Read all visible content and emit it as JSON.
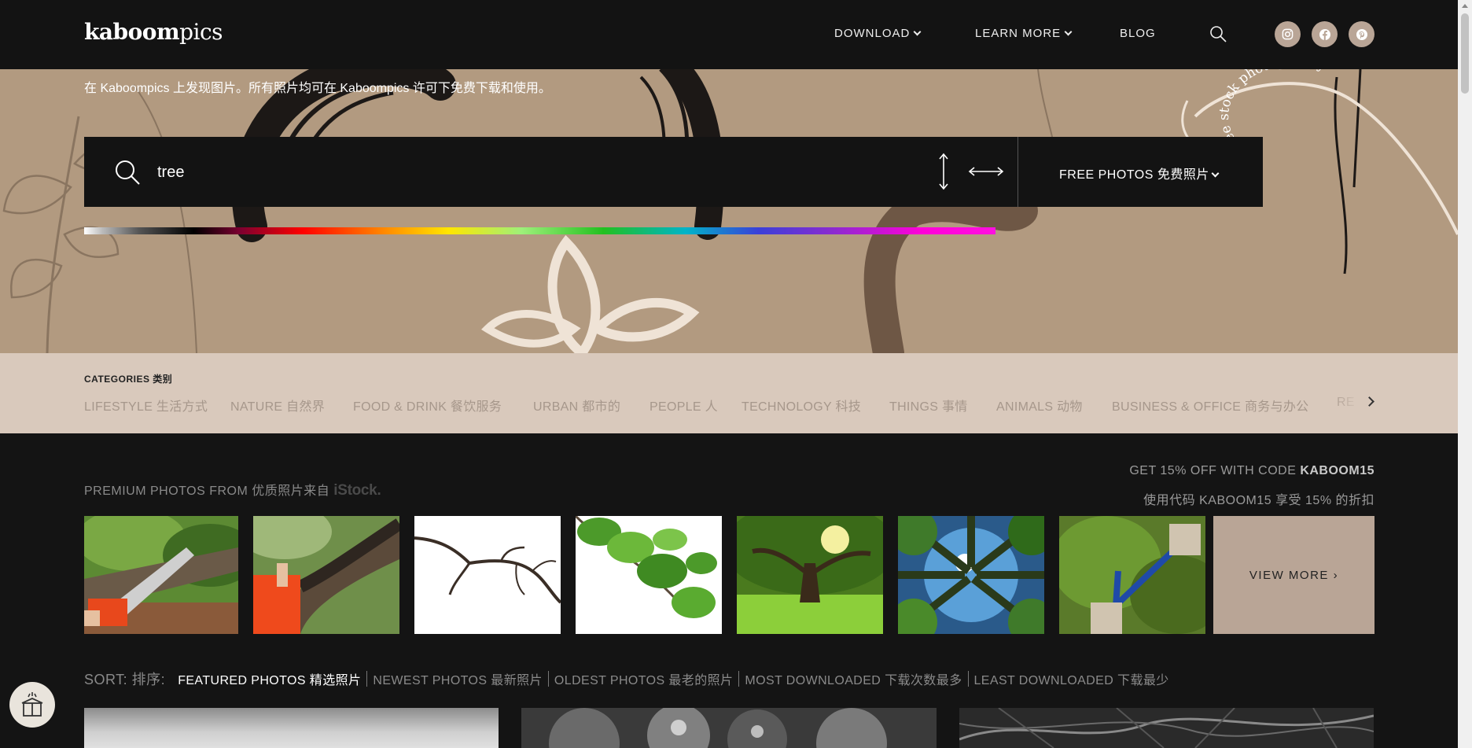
{
  "header": {
    "logo_bold": "kaboom",
    "logo_light": "pics",
    "nav": [
      {
        "label": "DOWNLOAD"
      },
      {
        "label": "LEARN MORE"
      },
      {
        "label": "BLOG"
      }
    ],
    "social": [
      "instagram-icon",
      "facebook-icon",
      "pinterest-icon"
    ]
  },
  "hero": {
    "tagline": "在 Kaboompics 上发现图片。所有照片均可在 Kaboompics 许可下免费下载和使用。",
    "watermark": "free stock photography",
    "search": {
      "value": "tree",
      "type_label": "FREE PHOTOS  免费照片"
    }
  },
  "categories": {
    "title": "CATEGORIES 类别",
    "items": [
      "LIFESTYLE 生活方式",
      "NATURE 自然界",
      "FOOD & DRINK 餐饮服务",
      "URBAN 都市的",
      "PEOPLE 人",
      "TECHNOLOGY 科技",
      "THINGS 事情",
      "ANIMALS 动物",
      "BUSINESS & OFFICE 商务与办公",
      "RE"
    ]
  },
  "premium": {
    "label": "PREMIUM PHOTOS FROM 优质照片来自",
    "brand": "iStock.",
    "promo_line1_prefix": "GET 15% OFF WITH CODE",
    "promo_code": "KABOOM15",
    "promo_line2": "使用代码 KABOOM15 享受 15% 的折扣",
    "view_more": "VIEW MORE ›"
  },
  "sort": {
    "label": "SORT: 排序:",
    "options": [
      "FEATURED PHOTOS 精选照片",
      "NEWEST PHOTOS 最新照片",
      "OLDEST PHOTOS 最老的照片",
      "MOST DOWNLOADED 下载次数最多",
      "LEAST DOWNLOADED 下载最少"
    ],
    "active_index": 0
  },
  "colors": {
    "header_bg": "#131313",
    "hero_bg": "#b29a80",
    "categories_bg": "#d9c9bc",
    "accent_tan": "#b9a596",
    "page_bg": "#141414"
  }
}
